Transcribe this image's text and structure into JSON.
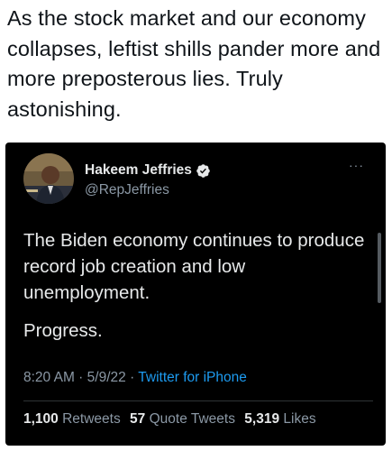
{
  "caption": "As the stock market and our economy collapses, leftist shills pander more and more preposterous lies. Truly astonishing.",
  "tweet": {
    "author_name": "Hakeem Jeffries",
    "handle": "@RepJeffries",
    "text_line1": "The Biden economy continues to produce record job creation and low unemployment.",
    "text_line2": "Progress.",
    "time": "8:20 AM",
    "separator": " · ",
    "date": "5/9/22",
    "source": "Twitter for iPhone",
    "more_icon": "···",
    "stats": {
      "retweets_count": "1,100",
      "retweets_label": "Retweets",
      "quotes_count": "57",
      "quotes_label": "Quote Tweets",
      "likes_count": "5,319",
      "likes_label": "Likes"
    }
  },
  "colors": {
    "card_bg": "#000000",
    "text": "#e7e9ea",
    "muted": "#8b98a5",
    "link": "#1d9bf0",
    "verified": "#e7e9ea"
  }
}
